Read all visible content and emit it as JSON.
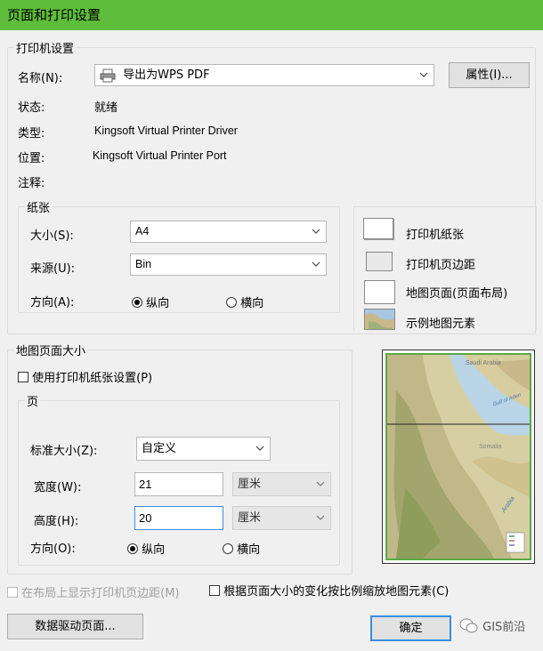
{
  "window": {
    "title": "页面和打印设置"
  },
  "printer_setup": {
    "legend": "打印机设置",
    "name_label": "名称(N):",
    "name_value": "导出为WPS PDF",
    "properties_button": "属性(I)...",
    "status_label": "状态:",
    "status_value": "就绪",
    "type_label": "类型:",
    "type_value": "Kingsoft Virtual Printer Driver",
    "location_label": "位置:",
    "location_value": "Kingsoft Virtual Printer Port",
    "comment_label": "注释:"
  },
  "paper": {
    "legend": "纸张",
    "size_label": "大小(S):",
    "size_value": "A4",
    "source_label": "来源(U):",
    "source_value": "Bin",
    "orientation_label": "方向(A):",
    "portrait_label": "纵向",
    "landscape_label": "横向",
    "orientation_selected": "portrait"
  },
  "legend_panel": {
    "items": [
      {
        "label": "打印机纸张",
        "swatch": "#ffffff"
      },
      {
        "label": "打印机页边距",
        "swatch": "#e8e8e8"
      },
      {
        "label": "地图页面(页面布局)",
        "swatch": "#ffffff"
      },
      {
        "label": "示例地图元素",
        "swatch": "map"
      }
    ]
  },
  "map_page_size": {
    "legend": "地图页面大小",
    "use_printer_paper_label": "使用打印机纸张设置(P)",
    "use_printer_paper_checked": false,
    "page_legend": "页",
    "standard_size_label": "标准大小(Z):",
    "standard_size_value": "自定义",
    "width_label": "宽度(W):",
    "width_value": "21",
    "width_unit": "厘米",
    "height_label": "高度(H):",
    "height_value": "20",
    "height_unit": "厘米",
    "orientation_label": "方向(O):",
    "portrait_label": "纵向",
    "landscape_label": "横向",
    "orientation_selected": "portrait"
  },
  "preview": {
    "labels": [
      "Saudi Arabia",
      "Gulf of Aden",
      "Somalia",
      "Arabia"
    ]
  },
  "options": {
    "show_margins_label": "在布局上显示打印机页边距(M)",
    "scale_elements_label": "根据页面大小的变化按比例缩放地图元素(C)"
  },
  "footer": {
    "data_driven_button": "数据驱动页面...",
    "ok_button": "确定",
    "watermark": "GIS前沿"
  },
  "colors": {
    "titlebar": "#5ebd3a",
    "dialog_bg": "#f0f0f0",
    "focus_border": "#3c8dde"
  }
}
